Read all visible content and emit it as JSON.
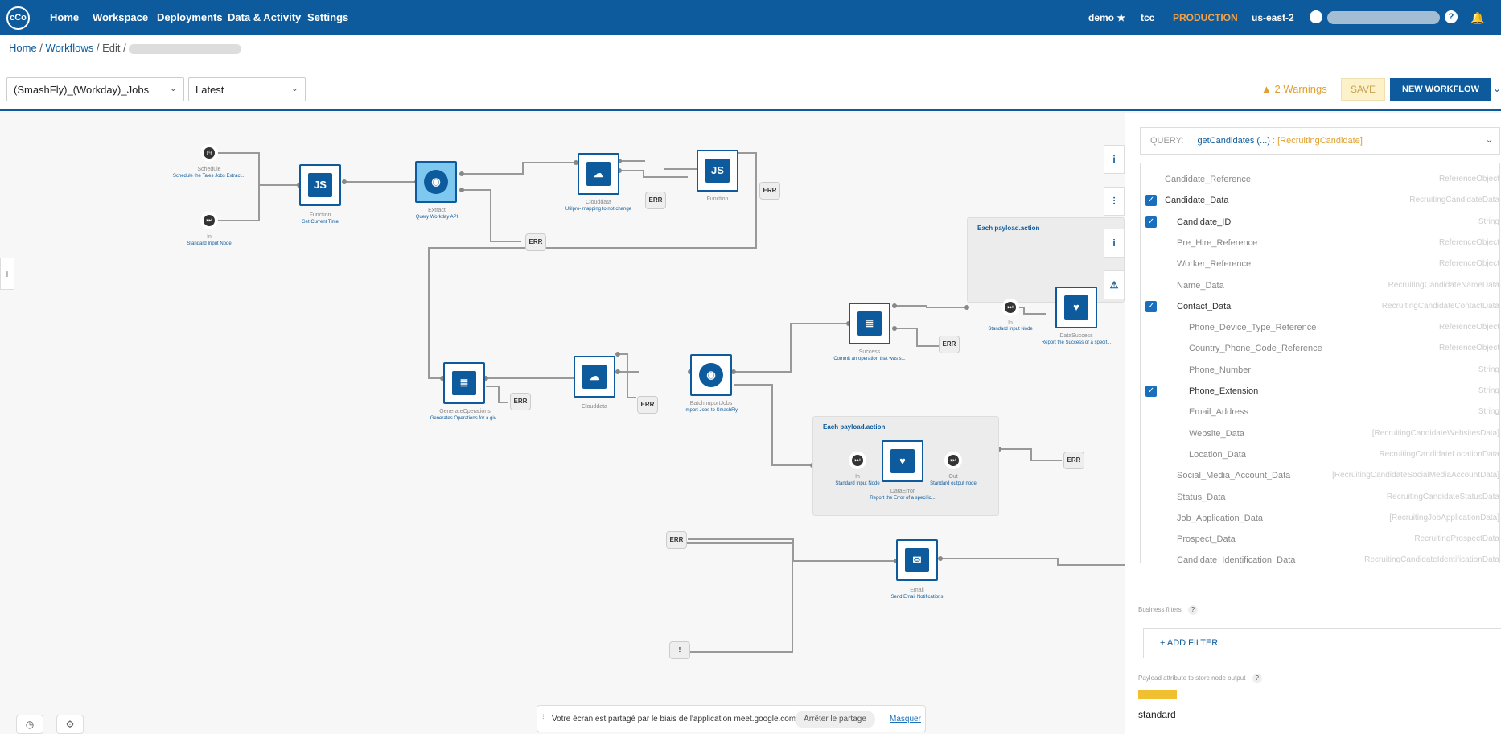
{
  "topbar": {
    "logo": "cCo",
    "nav": [
      "Home",
      "Workspace",
      "Deployments",
      "Data & Activity",
      "Settings"
    ],
    "right": {
      "demo": "demo ★",
      "tcc": "tcc",
      "env": "PRODUCTION",
      "region": "us-east-2"
    }
  },
  "breadcrumbs": {
    "home": "Home",
    "workflows": "Workflows",
    "edit": "Edit"
  },
  "toolbar": {
    "workflow_select": "(SmashFly)_(Workday)_Jobs",
    "version_select": "Latest",
    "warnings": "2 Warnings",
    "save": "SAVE",
    "new_workflow": "NEW WORKFLOW"
  },
  "nodes": {
    "schedule": {
      "label": "Schedule",
      "sub": "Schedule the Tales Jobs Extract..."
    },
    "input": {
      "label": "In",
      "sub": "Standard Input Node"
    },
    "function1": {
      "label": "Function",
      "sub": "Get Current Time"
    },
    "extract": {
      "label": "Extract",
      "sub": "Query Workday API"
    },
    "clouddata1": {
      "label": "Clouddata",
      "sub": "Utilpro- mapping to not change"
    },
    "function2": {
      "label": "Function",
      "sub": ""
    },
    "generate": {
      "label": "GenerateOperations",
      "sub": "Generates Operations for a giv..."
    },
    "clouddata2": {
      "label": "Clouddata",
      "sub": ""
    },
    "batch": {
      "label": "BatchImportJobs",
      "sub": "Import Jobs to SmashFly"
    },
    "success": {
      "label": "Success",
      "sub": "Commit an operation that was s..."
    },
    "group1_title": "Each payload.action",
    "group1_in": {
      "label": "In",
      "sub": "Standard Input Node"
    },
    "datasuccess": {
      "label": "DataSuccess",
      "sub": "Report the Success of a specif..."
    },
    "group2_title": "Each payload.action",
    "group2_in": {
      "label": "In",
      "sub": "Standard Input Node"
    },
    "dataerror": {
      "label": "DataError",
      "sub": "Report the Error of a specific..."
    },
    "group2_out": {
      "label": "Out",
      "sub": "Standard output node"
    },
    "email": {
      "label": "Email",
      "sub": "Send Email Notifications"
    },
    "err": "ERR",
    "bang": "!"
  },
  "sidebar": {
    "query_prefix": "QUERY:",
    "query_name": "getCandidates (...)",
    "query_type": ": [RecruitingCandidate]",
    "tree": [
      {
        "name": "Candidate_Reference",
        "type": "ReferenceObject",
        "checked": false,
        "indent": 0
      },
      {
        "name": "Candidate_Data",
        "type": "RecruitingCandidateData",
        "checked": true,
        "indent": 0
      },
      {
        "name": "Candidate_ID",
        "type": "String",
        "checked": true,
        "indent": 1
      },
      {
        "name": "Pre_Hire_Reference",
        "type": "ReferenceObject",
        "checked": false,
        "indent": 1
      },
      {
        "name": "Worker_Reference",
        "type": "ReferenceObject",
        "checked": false,
        "indent": 1
      },
      {
        "name": "Name_Data",
        "type": "RecruitingCandidateNameData",
        "checked": false,
        "indent": 1
      },
      {
        "name": "Contact_Data",
        "type": "RecruitingCandidateContactData",
        "checked": true,
        "indent": 1
      },
      {
        "name": "Phone_Device_Type_Reference",
        "type": "ReferenceObject",
        "checked": false,
        "indent": 2
      },
      {
        "name": "Country_Phone_Code_Reference",
        "type": "ReferenceObject",
        "checked": false,
        "indent": 2
      },
      {
        "name": "Phone_Number",
        "type": "String",
        "checked": false,
        "indent": 2
      },
      {
        "name": "Phone_Extension",
        "type": "String",
        "checked": true,
        "indent": 2
      },
      {
        "name": "Email_Address",
        "type": "String",
        "checked": false,
        "indent": 2
      },
      {
        "name": "Website_Data",
        "type": "[RecruitingCandidateWebsitesData]",
        "checked": false,
        "indent": 2
      },
      {
        "name": "Location_Data",
        "type": "RecruitingCandidateLocationData",
        "checked": false,
        "indent": 2
      },
      {
        "name": "Social_Media_Account_Data",
        "type": "[RecruitingCandidateSocialMediaAccountData]",
        "checked": false,
        "indent": 1
      },
      {
        "name": "Status_Data",
        "type": "RecruitingCandidateStatusData",
        "checked": false,
        "indent": 1
      },
      {
        "name": "Job_Application_Data",
        "type": "[RecruitingJobApplicationData]",
        "checked": false,
        "indent": 1
      },
      {
        "name": "Prospect_Data",
        "type": "RecruitingProspectData",
        "checked": false,
        "indent": 1
      },
      {
        "name": "Candidate_Identification_Data",
        "type": "RecruitingCandidateIdentificationData",
        "checked": false,
        "indent": 1
      }
    ],
    "business_filters": "Business filters",
    "add_filter": "+ ADD FILTER",
    "payload_label": "Payload attribute to store node output",
    "payload_value": "standard"
  },
  "share": {
    "text": "Votre écran est partagé par le biais de l'application meet.google.com.",
    "stop": "Arrêter le partage",
    "hide": "Masquer"
  }
}
